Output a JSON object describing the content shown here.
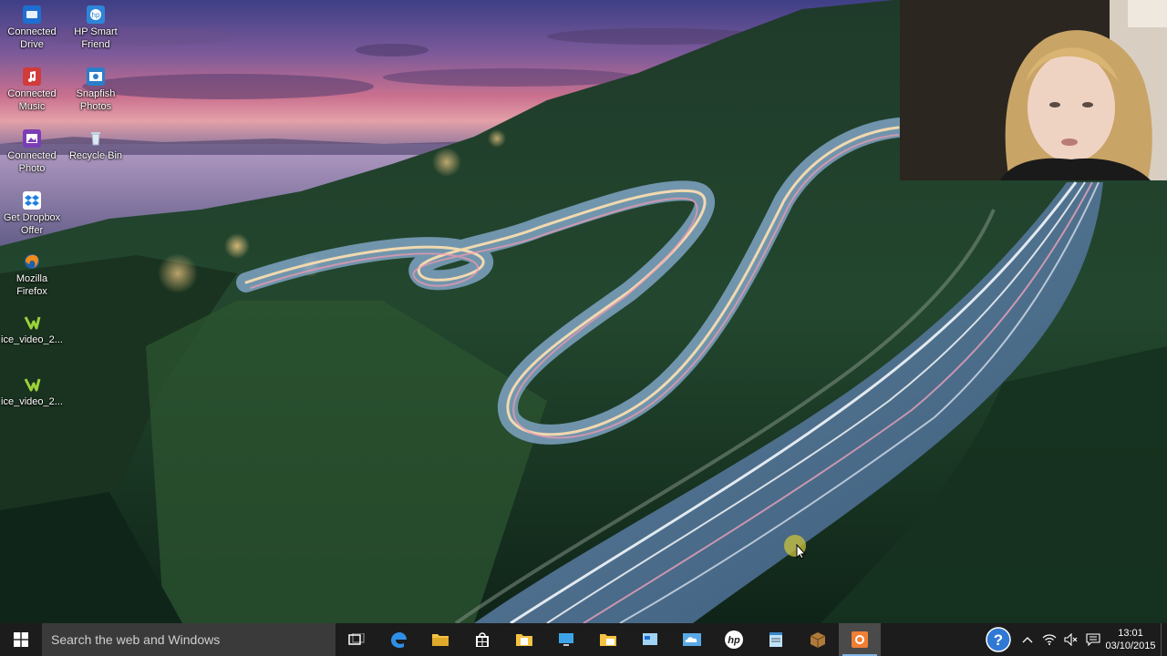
{
  "desktop_icons": [
    {
      "label_1": "Connected",
      "label_2": "Drive",
      "icon": "connected-drive-icon"
    },
    {
      "label_1": "HP Smart",
      "label_2": "Friend",
      "icon": "hp-smart-friend-icon"
    },
    {
      "label_1": "Connected",
      "label_2": "Music",
      "icon": "connected-music-icon"
    },
    {
      "label_1": "Snapfish",
      "label_2": "Photos",
      "icon": "snapfish-photos-icon"
    },
    {
      "label_1": "Connected",
      "label_2": "Photo",
      "icon": "connected-photo-icon"
    },
    {
      "label_1": "Recycle Bin",
      "label_2": "",
      "icon": "recycle-bin-icon"
    },
    {
      "label_1": "Get Dropbox",
      "label_2": "Offer",
      "icon": "dropbox-offer-icon"
    },
    {
      "label_1": "Mozilla",
      "label_2": "Firefox",
      "icon": "firefox-icon"
    },
    {
      "label_1": "ice_video_2...",
      "label_2": "",
      "icon": "video-file-icon"
    },
    {
      "label_1": "ice_video_2...",
      "label_2": "",
      "icon": "video-file-icon"
    }
  ],
  "taskbar": {
    "search_placeholder": "Search the web and Windows",
    "pinned": [
      "task-view",
      "edge",
      "file-explorer",
      "store",
      "documents",
      "remote-desktop",
      "file-manager",
      "onedrive",
      "hp",
      "notepad",
      "package",
      "recorder"
    ],
    "active_app": "recorder"
  },
  "tray": {
    "time": "13:01",
    "date": "03/10/2015"
  },
  "colors": {
    "taskbar_bg": "#1c1c1c",
    "search_bg": "#3a3a3a",
    "accent": "#7fb4e6"
  }
}
